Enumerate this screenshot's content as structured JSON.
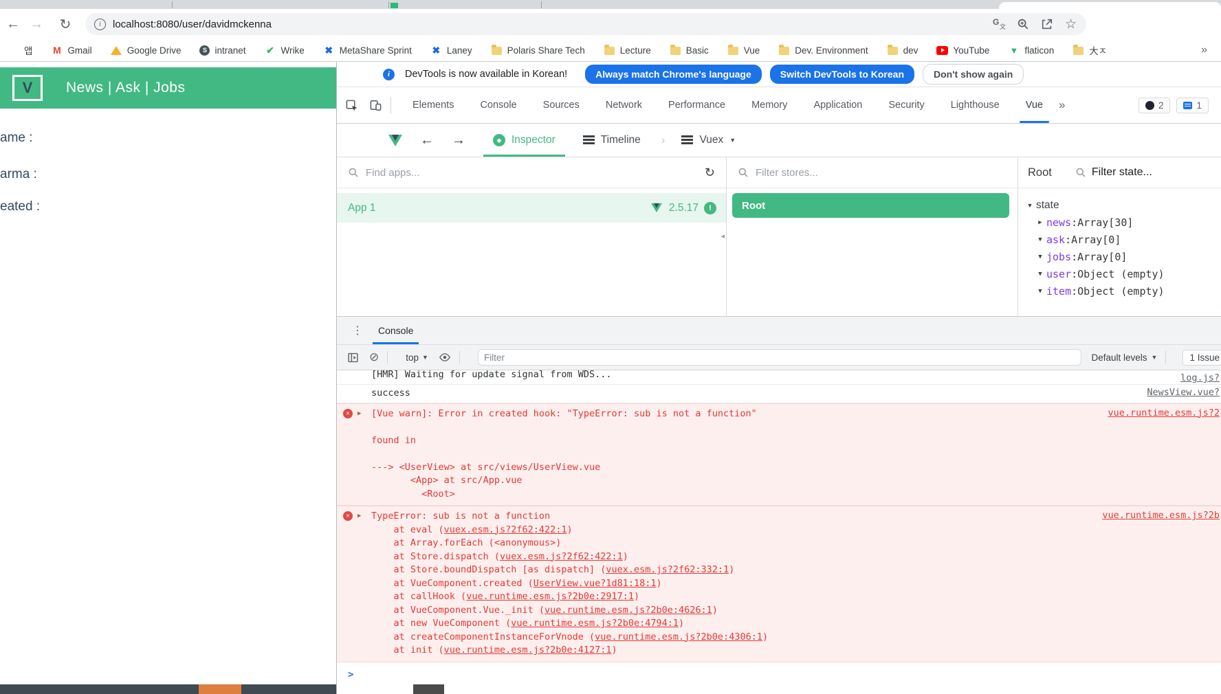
{
  "browser": {
    "url": "localhost:8080/user/davidmckenna",
    "more_chevron": "»",
    "bookmarks": [
      {
        "label": "앱",
        "icon": "apps-grid"
      },
      {
        "label": "Gmail",
        "icon": "gmail"
      },
      {
        "label": "Google Drive",
        "icon": "drive"
      },
      {
        "label": "intranet",
        "icon": "globe"
      },
      {
        "label": "Wrike",
        "icon": "wrike-check"
      },
      {
        "label": "MetaShare Sprint",
        "icon": "metashare-x"
      },
      {
        "label": "Laney",
        "icon": "laney-x"
      },
      {
        "label": "Polaris Share Tech",
        "icon": "folder"
      },
      {
        "label": "Lecture",
        "icon": "folder"
      },
      {
        "label": "Basic",
        "icon": "folder"
      },
      {
        "label": "Vue",
        "icon": "folder"
      },
      {
        "label": "Dev. Environment",
        "icon": "folder"
      },
      {
        "label": "dev",
        "icon": "folder"
      },
      {
        "label": "YouTube",
        "icon": "youtube"
      },
      {
        "label": "flaticon",
        "icon": "flaticon"
      },
      {
        "label": "大ㅈ",
        "icon": "folder"
      }
    ]
  },
  "page": {
    "nav_title": "News | Ask | Jobs",
    "logo_letter": "V",
    "fields": [
      "ame :",
      "arma :",
      "eated :"
    ]
  },
  "devtools": {
    "infobar": {
      "text": "DevTools is now available in Korean!",
      "btn_match": "Always match Chrome's language",
      "btn_switch": "Switch DevTools to Korean",
      "btn_dismiss": "Don't show again"
    },
    "tabs": [
      "Elements",
      "Console",
      "Sources",
      "Network",
      "Performance",
      "Memory",
      "Application",
      "Security",
      "Lighthouse",
      "Vue"
    ],
    "selected_tab": "Vue",
    "badges": {
      "errors": "2",
      "messages": "1"
    },
    "vue": {
      "tab_inspector": "Inspector",
      "tab_timeline": "Timeline",
      "tab_vuex": "Vuex",
      "find_apps_placeholder": "Find apps...",
      "filter_stores_placeholder": "Filter stores...",
      "app_name": "App 1",
      "app_version": "2.5.17",
      "store_root": "Root",
      "state_title": "Root",
      "filter_state_placeholder": "Filter state...",
      "state_root_label": "state",
      "state_entries": [
        {
          "key": "news",
          "value": "Array[30]",
          "expanded": false
        },
        {
          "key": "ask",
          "value": "Array[0]",
          "expanded": true
        },
        {
          "key": "jobs",
          "value": "Array[0]",
          "expanded": true
        },
        {
          "key": "user",
          "value": "Object (empty)",
          "expanded": true
        },
        {
          "key": "item",
          "value": "Object (empty)",
          "expanded": true
        }
      ]
    },
    "console": {
      "tab": "Console",
      "top_label": "top",
      "filter_placeholder": "Filter",
      "levels_label": "Default levels",
      "issues_label": "1 Issue",
      "prompt": ">",
      "messages": [
        {
          "kind": "log",
          "clipped": true,
          "source": "log.js?",
          "lines": [
            {
              "parts": [
                {
                  "text": "[HMR] Waiting for update signal from WDS..."
                }
              ]
            }
          ]
        },
        {
          "kind": "log",
          "source": "NewsView.vue?",
          "lines": [
            {
              "parts": [
                {
                  "text": "success"
                }
              ]
            }
          ]
        },
        {
          "kind": "error",
          "source": "vue.runtime.esm.js?2",
          "lines": [
            {
              "parts": [
                {
                  "text": "[Vue warn]: Error in created hook: \"TypeError: sub is not a function\""
                }
              ]
            },
            {
              "parts": [
                {
                  "text": ""
                }
              ]
            },
            {
              "parts": [
                {
                  "text": "found in"
                }
              ]
            },
            {
              "parts": [
                {
                  "text": ""
                }
              ]
            },
            {
              "parts": [
                {
                  "text": "---> <UserView> at src/views/UserView.vue"
                }
              ]
            },
            {
              "parts": [
                {
                  "text": "       <App> at src/App.vue"
                }
              ]
            },
            {
              "parts": [
                {
                  "text": "         <Root>"
                }
              ]
            }
          ]
        },
        {
          "kind": "error",
          "source": "vue.runtime.esm.js?2b",
          "lines": [
            {
              "parts": [
                {
                  "text": "TypeError: sub is not a function"
                }
              ]
            },
            {
              "parts": [
                {
                  "text": "    at eval ("
                },
                {
                  "link": "vuex.esm.js?2f62:422:1"
                },
                {
                  "text": ")"
                }
              ]
            },
            {
              "parts": [
                {
                  "text": "    at Array.forEach (<anonymous>)"
                }
              ]
            },
            {
              "parts": [
                {
                  "text": "    at Store.dispatch ("
                },
                {
                  "link": "vuex.esm.js?2f62:422:1"
                },
                {
                  "text": ")"
                }
              ]
            },
            {
              "parts": [
                {
                  "text": "    at Store.boundDispatch [as dispatch] ("
                },
                {
                  "link": "vuex.esm.js?2f62:332:1"
                },
                {
                  "text": ")"
                }
              ]
            },
            {
              "parts": [
                {
                  "text": "    at VueComponent.created ("
                },
                {
                  "link": "UserView.vue?1d81:18:1"
                },
                {
                  "text": ")"
                }
              ]
            },
            {
              "parts": [
                {
                  "text": "    at callHook ("
                },
                {
                  "link": "vue.runtime.esm.js?2b0e:2917:1"
                },
                {
                  "text": ")"
                }
              ]
            },
            {
              "parts": [
                {
                  "text": "    at VueComponent.Vue._init ("
                },
                {
                  "link": "vue.runtime.esm.js?2b0e:4626:1"
                },
                {
                  "text": ")"
                }
              ]
            },
            {
              "parts": [
                {
                  "text": "    at new VueComponent ("
                },
                {
                  "link": "vue.runtime.esm.js?2b0e:4794:1"
                },
                {
                  "text": ")"
                }
              ]
            },
            {
              "parts": [
                {
                  "text": "    at createComponentInstanceForVnode ("
                },
                {
                  "link": "vue.runtime.esm.js?2b0e:4306:1"
                },
                {
                  "text": ")"
                }
              ]
            },
            {
              "parts": [
                {
                  "text": "    at init ("
                },
                {
                  "link": "vue.runtime.esm.js?2b0e:4127:1"
                },
                {
                  "text": ")"
                }
              ]
            }
          ]
        }
      ]
    }
  }
}
